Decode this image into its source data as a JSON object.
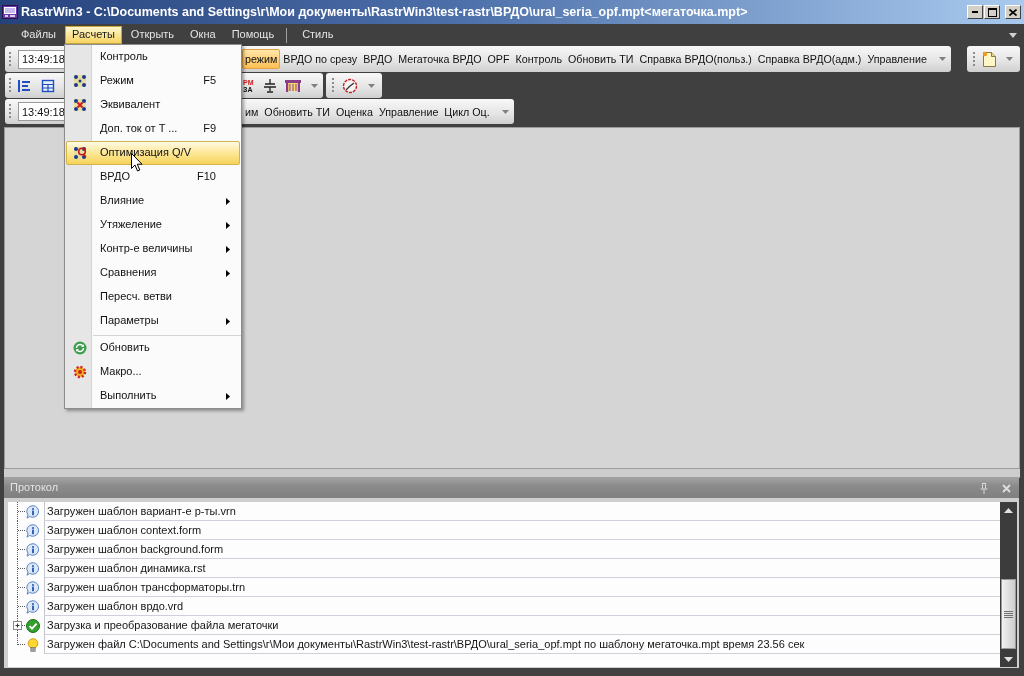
{
  "window": {
    "title": "RastrWin3 - C:\\Documents and Settings\\г\\Мои документы\\RastrWin3\\test-rastr\\ВРДО\\ural_seria_opf.mpt<мегаточка.mpt>"
  },
  "menu_bar": {
    "items": [
      {
        "kind": "item",
        "label": "Файлы",
        "selected": false
      },
      {
        "kind": "item",
        "label": "Расчеты",
        "selected": true
      },
      {
        "kind": "item",
        "label": "Открыть",
        "selected": false
      },
      {
        "kind": "item",
        "label": "Окна",
        "selected": false
      },
      {
        "kind": "item",
        "label": "Помощь",
        "selected": false
      },
      {
        "kind": "separator"
      },
      {
        "kind": "item",
        "label": "Стиль",
        "selected": false
      }
    ]
  },
  "toolbar_rows": [
    {
      "kind": "main",
      "combo_value": "13:49:18",
      "buttons": [
        {
          "label": "режим",
          "selected": true
        },
        {
          "label": "ВРДО по срезу",
          "selected": false
        },
        {
          "label": "ВРДО",
          "selected": false
        },
        {
          "label": "Мегаточка ВРДО",
          "selected": false
        },
        {
          "label": "OPF",
          "selected": false
        },
        {
          "label": "Контроль",
          "selected": false
        },
        {
          "label": "Обновить ТИ",
          "selected": false
        },
        {
          "label": "Справка ВРДО(польз.)",
          "selected": false
        },
        {
          "label": "Справка ВРДО(адм.)",
          "selected": false
        },
        {
          "label": "Управление",
          "selected": false
        }
      ]
    },
    {
      "kind": "icons",
      "tool_text": [
        "PM",
        "ЗА"
      ]
    },
    {
      "kind": "secondary",
      "combo_value": "13:49:18",
      "buttons": [
        {
          "label": "им",
          "selected": false
        },
        {
          "label": "Обновить ТИ",
          "selected": false
        },
        {
          "label": "Оценка",
          "selected": false
        },
        {
          "label": "Управление",
          "selected": false
        },
        {
          "label": "Цикл Оц.",
          "selected": false
        }
      ]
    }
  ],
  "open_menu": {
    "items": [
      {
        "kind": "command",
        "label": "Контроль",
        "selected": false,
        "submenu": false
      },
      {
        "kind": "mode",
        "label": "Режим",
        "shortcut": "F5",
        "selected": false,
        "submenu": false
      },
      {
        "kind": "equivalent",
        "label": "Эквивалент",
        "selected": false,
        "submenu": false
      },
      {
        "kind": "command",
        "label": "Доп. ток от T ...",
        "shortcut": "F9",
        "selected": false,
        "submenu": false
      },
      {
        "kind": "optimization",
        "label": "Оптимизация Q/V",
        "selected": true,
        "submenu": false
      },
      {
        "kind": "command",
        "label": "ВРДО",
        "shortcut": "F10",
        "selected": false,
        "submenu": false
      },
      {
        "kind": "command",
        "label": "Влияние",
        "selected": false,
        "submenu": true
      },
      {
        "kind": "command",
        "label": "Утяжеление",
        "selected": false,
        "submenu": true
      },
      {
        "kind": "command",
        "label": "Контр-е величины",
        "selected": false,
        "submenu": true
      },
      {
        "kind": "command",
        "label": "Сравнения",
        "selected": false,
        "submenu": true
      },
      {
        "kind": "command",
        "label": "Пересч. ветви",
        "selected": false,
        "submenu": false
      },
      {
        "kind": "command",
        "label": "Параметры",
        "selected": false,
        "submenu": true
      },
      {
        "kind": "separator"
      },
      {
        "kind": "refresh",
        "label": "Обновить",
        "selected": false,
        "submenu": false
      },
      {
        "kind": "macro",
        "label": "Макро...",
        "selected": false,
        "submenu": false
      },
      {
        "kind": "command",
        "label": "Выполнить",
        "selected": false,
        "submenu": true
      }
    ]
  },
  "protocol": {
    "title": "Протокол",
    "rows": [
      {
        "kind": "info",
        "text": "Загружен шаблон вариант-е р-ты.vrn"
      },
      {
        "kind": "info",
        "text": "Загружен шаблон context.form"
      },
      {
        "kind": "info",
        "text": "Загружен шаблон background.form"
      },
      {
        "kind": "info",
        "text": "Загружен шаблон динамика.rst"
      },
      {
        "kind": "info",
        "text": "Загружен шаблон трансформаторы.trn"
      },
      {
        "kind": "info",
        "text": "Загружен шаблон врдо.vrd"
      },
      {
        "kind": "success",
        "text": "Загрузка и преобразование файла мегаточки",
        "expanded": false
      },
      {
        "kind": "hint",
        "text": "Загружен файл C:\\Documents and Settings\\г\\Мои документы\\RastrWin3\\test-rastr\\ВРДО\\ural_seria_opf.mpt по шаблону мегаточка.mpt время 23.56 сек"
      }
    ]
  }
}
